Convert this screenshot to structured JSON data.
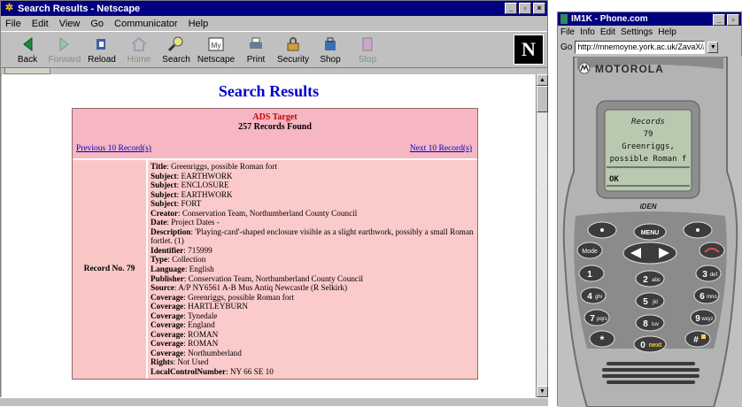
{
  "netscape": {
    "title": "Search Results - Netscape",
    "menu": [
      "File",
      "Edit",
      "View",
      "Go",
      "Communicator",
      "Help"
    ],
    "toolbar": [
      {
        "label": "Back",
        "enabled": true,
        "icon": "back-arrow-icon"
      },
      {
        "label": "Forward",
        "enabled": false,
        "icon": "forward-arrow-icon"
      },
      {
        "label": "Reload",
        "enabled": true,
        "icon": "reload-icon"
      },
      {
        "label": "Home",
        "enabled": false,
        "icon": "home-icon"
      },
      {
        "label": "Search",
        "enabled": true,
        "icon": "search-icon"
      },
      {
        "label": "Netscape",
        "enabled": true,
        "icon": "netscape-icon"
      },
      {
        "label": "Print",
        "enabled": true,
        "icon": "print-icon"
      },
      {
        "label": "Security",
        "enabled": true,
        "icon": "security-lock-icon"
      },
      {
        "label": "Shop",
        "enabled": true,
        "icon": "shop-icon"
      },
      {
        "label": "Stop",
        "enabled": false,
        "icon": "stop-icon"
      }
    ],
    "logo": "N"
  },
  "page": {
    "heading": "Search Results",
    "target": "ADS Target",
    "found": "257 Records Found",
    "prev_link": "Previous 10 Record(s)",
    "next_link": "Next 10 Record(s)",
    "record_label": "Record No. 79",
    "fields": [
      {
        "k": "Title",
        "v": "Greenriggs, possible Roman fort"
      },
      {
        "k": "Subject",
        "v": "EARTHWORK"
      },
      {
        "k": "Subject",
        "v": "ENCLOSURE"
      },
      {
        "k": "Subject",
        "v": "EARTHWORK"
      },
      {
        "k": "Subject",
        "v": "FORT"
      },
      {
        "k": "Creator",
        "v": "Conservation Team, Northumberland County Council"
      },
      {
        "k": "Date",
        "v": "Project Dates -"
      },
      {
        "k": "Description",
        "v": "'Playing-card'-shaped enclosure visible as a slight earthwork, possibly a small Roman fortlet. (1)"
      },
      {
        "k": "Identifier",
        "v": "715999"
      },
      {
        "k": "Type",
        "v": "Collection"
      },
      {
        "k": "Language",
        "v": "English"
      },
      {
        "k": "Publisher",
        "v": "Conservation Team, Northumberland County Council"
      },
      {
        "k": "Source",
        "v": "A/P NY6561 A-B Mus Antiq Newcastle (R Selkirk)"
      },
      {
        "k": "Coverage",
        "v": "Greenriggs, possible Roman fort"
      },
      {
        "k": "Coverage",
        "v": "HARTLEYBURN"
      },
      {
        "k": "Coverage",
        "v": "Tynedale"
      },
      {
        "k": "Coverage",
        "v": "England"
      },
      {
        "k": "Coverage",
        "v": "ROMAN"
      },
      {
        "k": "Coverage",
        "v": "ROMAN"
      },
      {
        "k": "Coverage",
        "v": "Northumberland"
      },
      {
        "k": "Rights",
        "v": "Not Used"
      },
      {
        "k": "LocalControlNumber",
        "v": "NY 66 SE 10"
      }
    ]
  },
  "phone": {
    "title": "IM1K - Phone.com",
    "menu": [
      "File",
      "Info",
      "Edit",
      "Settings",
      "Help"
    ],
    "go_label": "Go",
    "url": "http://mnemoyne.york.ac.uk/ZavaX/ads",
    "brand": "MOTOROLA",
    "model": "iDEN",
    "screen_lines": [
      "Records",
      "79",
      "Greenriggs,",
      "possible Roman f"
    ],
    "softkey": "OK",
    "keys": {
      "mode": "Mode",
      "menu": "MENU",
      "k1": "1",
      "k2": "2",
      "k2s": "abc",
      "k3": "3",
      "k3s": "def",
      "k4": "4",
      "k4s": "ghi",
      "k5": "5",
      "k5s": "jkl",
      "k6": "6",
      "k6s": "mno",
      "k7": "7",
      "k7s": "pqrs",
      "k8": "8",
      "k8s": "tuv",
      "k9": "9",
      "k9s": "wxyz",
      "star": "*",
      "k0": "0",
      "k0s": "next",
      "hash": "#"
    }
  },
  "colors": {
    "titlebar": "#000080",
    "heading": "#0000cc",
    "record_bg": "#f8c8c8",
    "screen": "#b9c9b0",
    "phone_body": "#b8b8b8"
  }
}
